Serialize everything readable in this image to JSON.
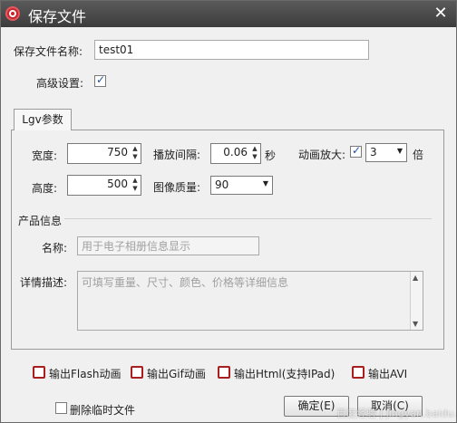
{
  "window": {
    "title": "保存文件",
    "close_glyph": "✕",
    "icon": "app-logo-icon"
  },
  "filename": {
    "label": "保存文件名称:",
    "value": "test01"
  },
  "advanced": {
    "label": "高级设置:",
    "checked": true
  },
  "tab": {
    "label": "Lgv参数"
  },
  "params": {
    "width": {
      "label": "宽度:",
      "value": "750"
    },
    "height": {
      "label": "高度:",
      "value": "500"
    },
    "interval": {
      "label": "播放间隔:",
      "value": "0.06",
      "unit": "秒"
    },
    "quality": {
      "label": "图像质量:",
      "value": "90"
    },
    "zoom": {
      "label": "动画放大:",
      "checked": true,
      "value": "3",
      "unit": "倍"
    }
  },
  "product": {
    "section_title": "产品信息",
    "name_label": "名称:",
    "name_placeholder": "用于电子相册信息显示",
    "detail_label": "详情描述:",
    "detail_placeholder": "可填写重量、尺寸、颜色、价格等详细信息"
  },
  "outputs": {
    "flash": {
      "label": "输出Flash动画",
      "checked": false
    },
    "gif": {
      "label": "输出Gif动画",
      "checked": false
    },
    "html": {
      "label": "输出Html(支持IPad)",
      "checked": false
    },
    "avi": {
      "label": "输出AVI",
      "checked": false
    }
  },
  "delete_temp": {
    "label": "删除临时文件",
    "checked": false
  },
  "buttons": {
    "ok": "确定(E)",
    "cancel": "取消(C)"
  },
  "watermark": "百度经验 | jingyan.baidu.com"
}
